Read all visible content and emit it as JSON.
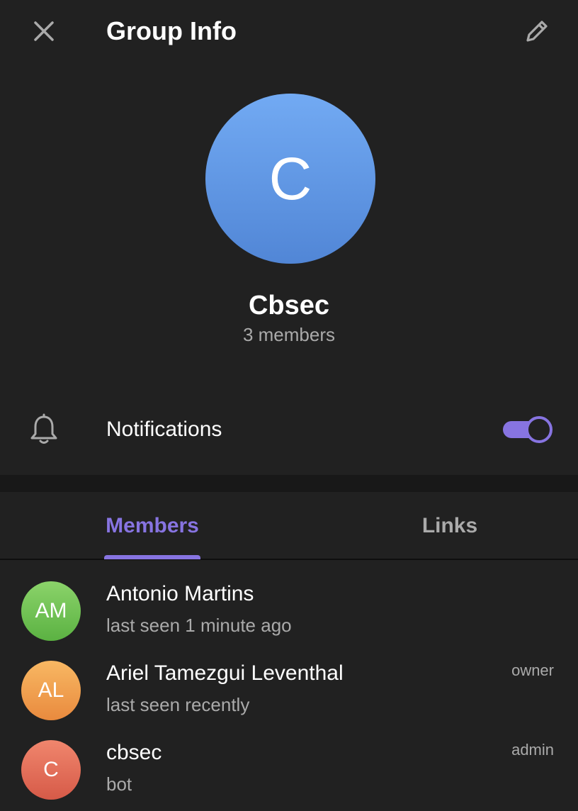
{
  "header": {
    "title": "Group Info",
    "close_icon": "close-icon",
    "edit_icon": "pencil-icon"
  },
  "group": {
    "avatar_initial": "C",
    "name": "Cbsec",
    "member_count": "3 members",
    "avatar_color": "#6a9de6"
  },
  "notifications": {
    "label": "Notifications",
    "icon": "bell-icon",
    "enabled": true
  },
  "tabs": [
    {
      "label": "Members",
      "active": true
    },
    {
      "label": "Links",
      "active": false
    }
  ],
  "accent_color": "#8774e1",
  "members": [
    {
      "initials": "AM",
      "name": "Antonio Martins",
      "status": "last seen 1 minute ago",
      "role": "",
      "avatar_color": "#6fbf52"
    },
    {
      "initials": "AL",
      "name": "Ariel Tamezgui Leventhal",
      "status": "last seen recently",
      "role": "owner",
      "avatar_color": "#ef9f4c"
    },
    {
      "initials": "C",
      "name": "cbsec",
      "status": "bot",
      "role": "admin",
      "avatar_color": "#e66e56"
    }
  ]
}
